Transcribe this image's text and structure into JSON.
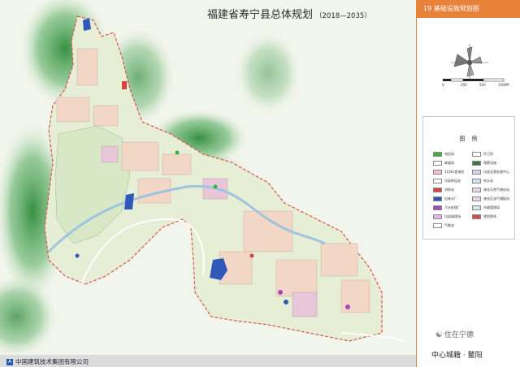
{
  "title": {
    "main": "福建省寿宁县总体规划",
    "years": "（2018—2035）"
  },
  "panel": {
    "header": "19  基础设施规划图",
    "scale": {
      "ticks": [
        "0",
        "200",
        "500",
        "1000M"
      ]
    },
    "legend_title": "图 例",
    "legend_items": [
      {
        "label": "电信局",
        "color": "#3fae49"
      },
      {
        "label": "环卫所",
        "color": "#ffffff"
      },
      {
        "label": "邮政局",
        "color": "#ffffff"
      },
      {
        "label": "殡葬设施",
        "color": "#3a7a3a"
      },
      {
        "label": "110kv变电所",
        "color": "#f3c0d4"
      },
      {
        "label": "垃圾无害处理中心",
        "color": "#cfd7e8"
      },
      {
        "label": "垃圾转运站",
        "color": "#ffffff"
      },
      {
        "label": "给水站",
        "color": "#cfe3f3"
      },
      {
        "label": "消防站",
        "color": "#d9443c"
      },
      {
        "label": "液化天然气储存站",
        "color": "#e9d6ec"
      },
      {
        "label": "自来水厂",
        "color": "#2f58b8"
      },
      {
        "label": "液化石油气储配站",
        "color": "#e9d6ec"
      },
      {
        "label": "污水处理厂",
        "color": "#a24bb2"
      },
      {
        "label": "市政管理局",
        "color": "#cfe9e6"
      },
      {
        "label": "垃圾填埋场",
        "color": "#e2b7e3"
      },
      {
        "label": "规划界线",
        "color": "#d04b4b"
      },
      {
        "label": "气象站",
        "color": "#ffffff"
      }
    ]
  },
  "watermark": "住在宁德",
  "footer_label": "中心城籍 · 鳌阳",
  "logo_text": "中国建筑技术集团有限公司",
  "logo_mark": "A"
}
